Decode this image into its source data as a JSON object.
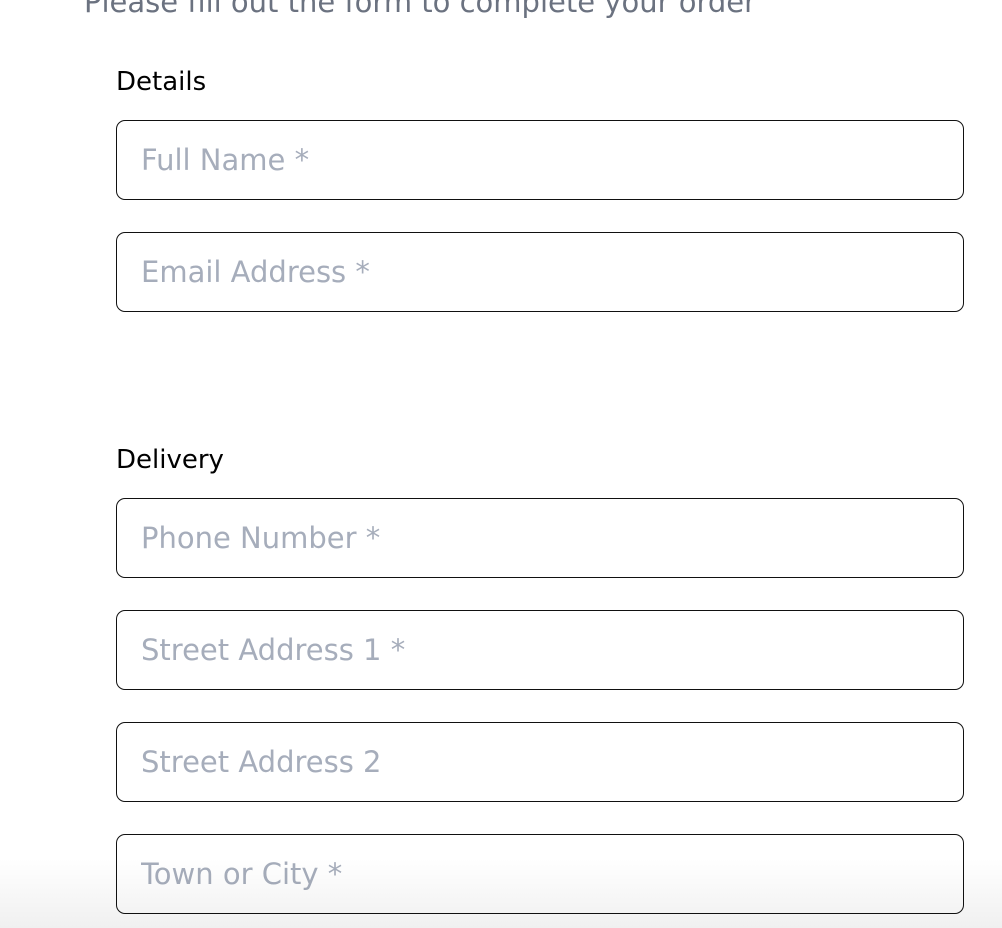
{
  "header": {
    "intro": "Please fill out the form to complete your order"
  },
  "details": {
    "label": "Details",
    "full_name_placeholder": "Full Name *",
    "email_placeholder": "Email Address *"
  },
  "delivery": {
    "label": "Delivery",
    "phone_placeholder": "Phone Number *",
    "street1_placeholder": "Street Address 1 *",
    "street2_placeholder": "Street Address 2",
    "town_placeholder": "Town or City *"
  }
}
